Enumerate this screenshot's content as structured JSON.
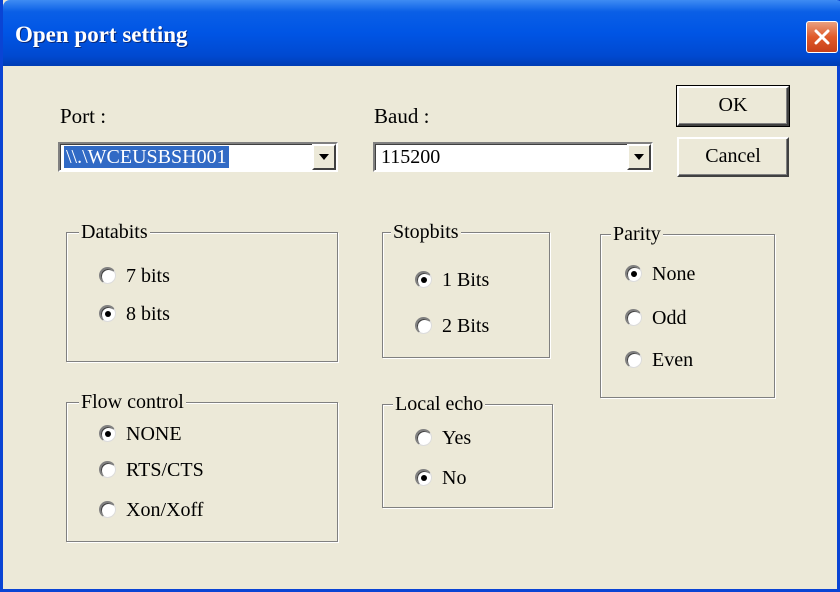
{
  "window": {
    "title": "Open port setting"
  },
  "port": {
    "label": "Port :",
    "value": "\\\\.\\WCEUSBSH001"
  },
  "baud": {
    "label": "Baud :",
    "value": "115200"
  },
  "buttons": {
    "ok": "OK",
    "cancel": "Cancel"
  },
  "databits": {
    "title": "Databits",
    "options": [
      "7 bits",
      "8 bits"
    ],
    "selected": "8 bits"
  },
  "stopbits": {
    "title": "Stopbits",
    "options": [
      "1 Bits",
      "2 Bits"
    ],
    "selected": "1 Bits"
  },
  "parity": {
    "title": "Parity",
    "options": [
      "None",
      "Odd",
      "Even"
    ],
    "selected": "None"
  },
  "flow_control": {
    "title": "Flow control",
    "options": [
      "NONE",
      "RTS/CTS",
      "Xon/Xoff"
    ],
    "selected": "NONE"
  },
  "local_echo": {
    "title": "Local echo",
    "options": [
      "Yes",
      "No"
    ],
    "selected": "No"
  },
  "icons": {
    "close": "close-icon",
    "dropdown": "chevron-down-icon",
    "radio": "radio-button-icon"
  },
  "colors": {
    "titlebar": "#0055e5",
    "close": "#e05a2a",
    "selection": "#316ac5",
    "face": "#ece9d8"
  }
}
